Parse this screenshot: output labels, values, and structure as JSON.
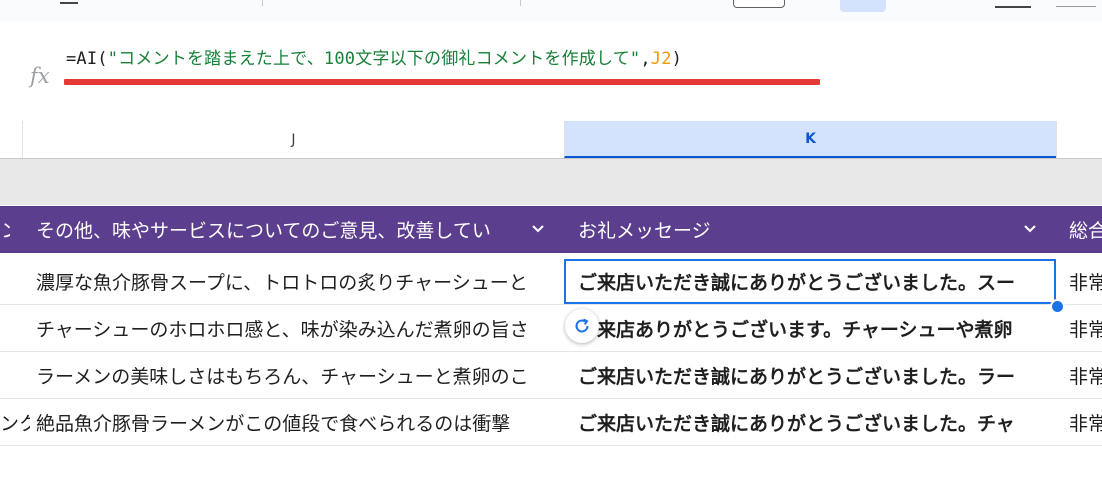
{
  "formula": {
    "prefix": "=AI(",
    "string_arg": "\"コメントを踏まえた上で、100文字以下の御礼コメントを作成して\"",
    "comma": ",",
    "ref_arg": "J2",
    "suffix": ")",
    "fx_label": "fx"
  },
  "columns": {
    "j_label": "J",
    "k_label": "K"
  },
  "table_header": {
    "col_prev_fragment": "ン",
    "col_j": "その他、味やサービスについてのご意見、改善してい",
    "col_k": "お礼メッセージ",
    "col_next": "総合"
  },
  "rows": [
    {
      "prev": "",
      "j": "濃厚な魚介豚骨スープに、トロトロの炙りチャーシューと",
      "k": "ご来店いただき誠にありがとうございました。スー",
      "next": "非常"
    },
    {
      "prev": "",
      "j": "チャーシューのホロホロ感と、味が染み込んだ煮卵の旨さ",
      "k": "ご来店ありがとうございます。チャーシューや煮卵",
      "next": "非常"
    },
    {
      "prev": "",
      "j": "ラーメンの美味しさはもちろん、チャーシューと煮卵のこ",
      "k": "ご来店いただき誠にありがとうございました。ラー",
      "next": "非常"
    },
    {
      "prev": "ンク",
      "j": "絶品魚介豚骨ラーメンがこの値段で食べられるのは衝撃",
      "k": "ご来店いただき誠にありがとうございました。チャ",
      "next": "非常"
    }
  ],
  "colors": {
    "header_purple": "#5c3e8e",
    "selection_blue": "#1a73e8",
    "error_underline": "#e53935"
  }
}
